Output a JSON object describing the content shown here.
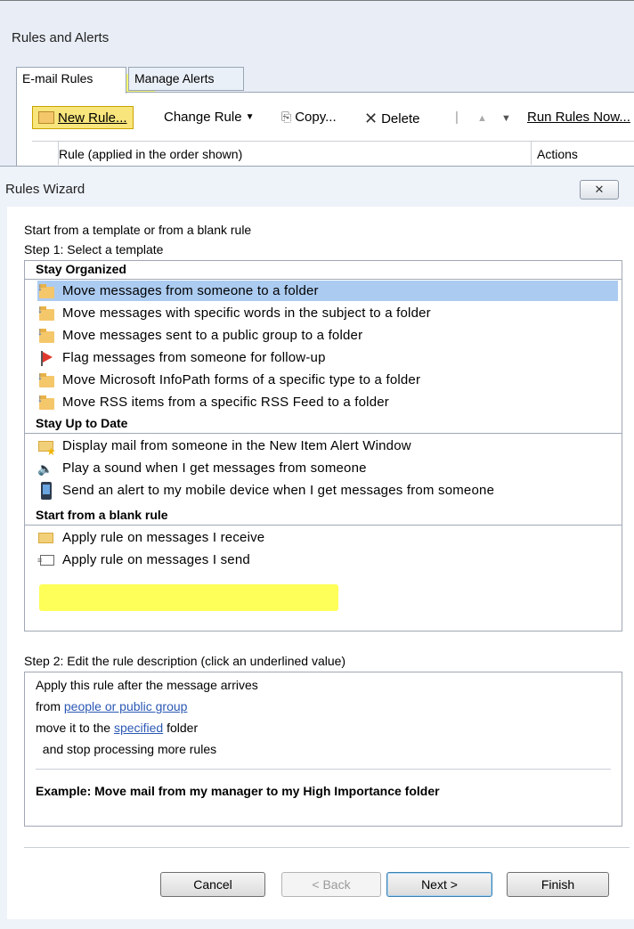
{
  "rules_alerts": {
    "title": "Rules and Alerts",
    "tabs": [
      "E-mail Rules",
      "Manage Alerts"
    ],
    "toolbar": {
      "new_rule": "New Rule...",
      "change_rule": "Change Rule",
      "copy": "Copy...",
      "delete": "Delete",
      "run_rules_now": "Run Rules Now..."
    },
    "columns": {
      "rule": "Rule (applied in the order shown)",
      "actions": "Actions"
    }
  },
  "wizard": {
    "title": "Rules Wizard",
    "close_label": "✕",
    "intro": "Start from a template or from a blank rule",
    "step1": "Step 1: Select a template",
    "groups": [
      {
        "name": "Stay Organized",
        "items": [
          "Move messages from someone to a folder",
          "Move messages with specific words in the subject to a folder",
          "Move messages sent to a public group to a folder",
          "Flag messages from someone for follow-up",
          "Move Microsoft InfoPath forms of a specific type to a folder",
          "Move RSS items from a specific RSS Feed to a folder"
        ]
      },
      {
        "name": "Stay Up to Date",
        "items": [
          "Display mail from someone in the New Item Alert Window",
          "Play a sound when I get messages from someone",
          "Send an alert to my mobile device when I get messages from someone"
        ]
      },
      {
        "name": "Start from a blank rule",
        "items": [
          "Apply rule on messages I receive",
          "Apply rule on messages I send"
        ]
      }
    ],
    "selected_item": "Move messages from someone to a folder",
    "step2": "Step 2: Edit the rule description (click an underlined value)",
    "description": {
      "line1": "Apply this rule after the message arrives",
      "line2_prefix": "from ",
      "line2_link": "people or public group",
      "line3_prefix": "move it to the ",
      "line3_link": "specified",
      "line3_suffix": " folder",
      "line4": "  and stop processing more rules",
      "example": "Example: Move mail from my manager to my High Importance folder"
    },
    "buttons": {
      "cancel": "Cancel",
      "back": "< Back",
      "next": "Next >",
      "finish": "Finish"
    },
    "highlight_color": "#ffff00",
    "selection_color": "#accbf0",
    "link_color": "#2b58b4"
  }
}
